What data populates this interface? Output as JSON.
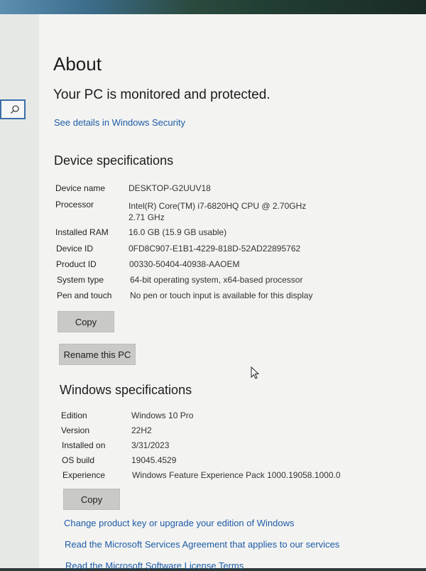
{
  "search": {
    "icon": "search-icon"
  },
  "about": {
    "title": "About",
    "protection_message": "Your PC is monitored and protected.",
    "security_link": "See details in Windows Security"
  },
  "device_specs": {
    "heading": "Device specifications",
    "rows": [
      {
        "label": "Device name",
        "value": "DESKTOP-G2UUV18"
      },
      {
        "label": "Processor",
        "value": "Intel(R) Core(TM) i7-6820HQ CPU @ 2.70GHz   2.71 GHz"
      },
      {
        "label": "Installed RAM",
        "value": "16.0 GB (15.9 GB usable)"
      },
      {
        "label": "Device ID",
        "value": "0FD8C907-E1B1-4229-818D-52AD22895762"
      },
      {
        "label": "Product ID",
        "value": "00330-50404-40938-AAOEM"
      },
      {
        "label": "System type",
        "value": "64-bit operating system, x64-based processor"
      },
      {
        "label": "Pen and touch",
        "value": "No pen or touch input is available for this display"
      }
    ],
    "copy_label": "Copy",
    "rename_label": "Rename this PC"
  },
  "windows_specs": {
    "heading": "Windows specifications",
    "rows": [
      {
        "label": "Edition",
        "value": "Windows 10 Pro"
      },
      {
        "label": "Version",
        "value": "22H2"
      },
      {
        "label": "Installed on",
        "value": "3/31/2023"
      },
      {
        "label": "OS build",
        "value": "19045.4529"
      },
      {
        "label": "Experience",
        "value": "Windows Feature Experience Pack 1000.19058.1000.0"
      }
    ],
    "copy_label": "Copy"
  },
  "links": {
    "product_key": "Change product key or upgrade your edition of Windows",
    "services_agreement": "Read the Microsoft Services Agreement that applies to our services",
    "license_terms": "Read the Microsoft Software License Terms"
  }
}
